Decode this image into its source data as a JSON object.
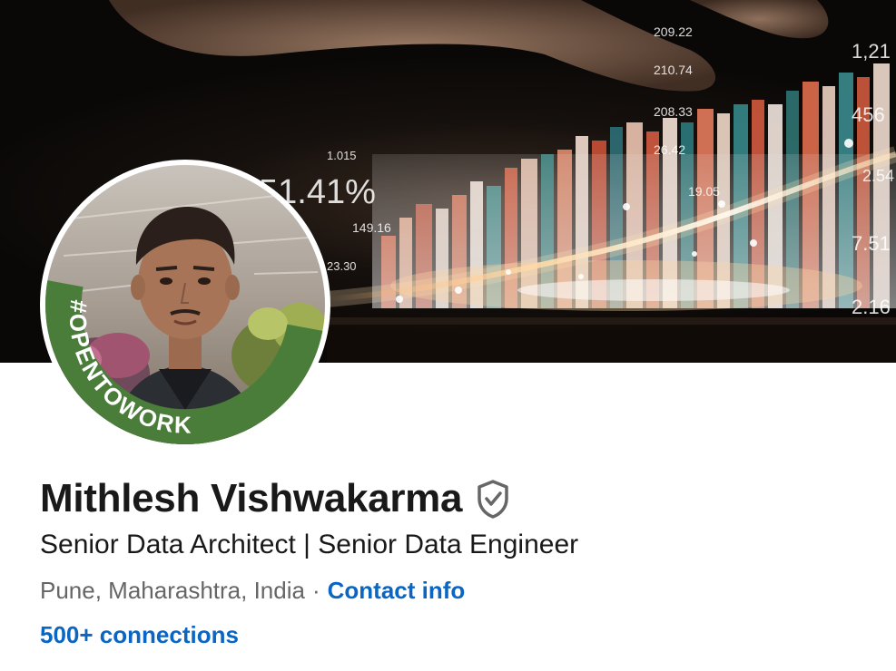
{
  "profile": {
    "name": "Mithlesh Vishwakarma",
    "headline": "Senior Data Architect | Senior Data Engineer",
    "location": "Pune, Maharashtra, India",
    "separator": "·",
    "contact_info_label": "Contact info",
    "connections_label": "500+ connections",
    "open_to_work_frame_text": "#OPENTOWORK"
  },
  "banner": {
    "overlay_numbers": [
      "209.22",
      "210.74",
      "208.33",
      "26.42",
      "1.015",
      "51.41%",
      "149.16",
      "23.30",
      "19.05",
      "1,21",
      "456",
      "7.51",
      "2.16",
      "2.54"
    ]
  },
  "colors": {
    "link_blue": "#0a66c2",
    "open_to_work_green": "#4a7c3a",
    "text_primary": "rgba(0,0,0,0.9)",
    "text_secondary": "#666666"
  },
  "icons": {
    "verified": "verified-shield-icon"
  }
}
